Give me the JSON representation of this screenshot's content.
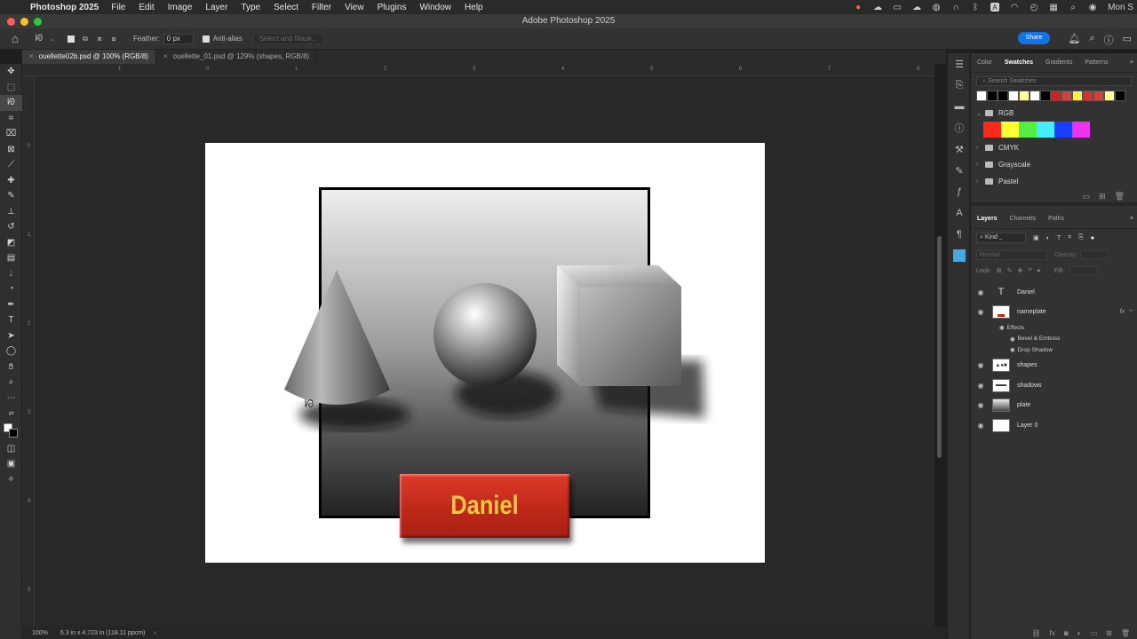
{
  "menubar": {
    "app": "Photoshop 2025",
    "items": [
      "File",
      "Edit",
      "Image",
      "Layer",
      "Type",
      "Select",
      "Filter",
      "View",
      "Plugins",
      "Window",
      "Help"
    ],
    "clock": "Mon S"
  },
  "window_title": "Adobe Photoshop 2025",
  "options": {
    "feather_label": "Feather:",
    "feather_value": "0 px",
    "antialias_label": "Anti-alias",
    "select_mask_label": "Select and Mask...",
    "share_label": "Share"
  },
  "tabs": [
    {
      "label": "ouellette02b.psd @ 100% (RGB/8)",
      "active": true
    },
    {
      "label": "ouellette_01.psd @ 129% (shapes, RGB/8)",
      "active": false
    }
  ],
  "rulers": {
    "h": [
      "1",
      "0",
      "1",
      "2",
      "3",
      "4",
      "5",
      "6",
      "7",
      "8"
    ],
    "v": [
      "0",
      "1",
      "2",
      "3",
      "4",
      "5"
    ]
  },
  "canvas": {
    "nameplate_text": "Daniel",
    "nameplate_color": "#c02a1a",
    "nameplate_text_color": "#f5c842"
  },
  "status": {
    "zoom": "100%",
    "doc_info": "6.3 in x 4.723 in (118.11 ppcm)"
  },
  "swatches_panel": {
    "tabs": [
      "Color",
      "Swatches",
      "Gradients",
      "Patterns"
    ],
    "active_tab": "Swatches",
    "search_placeholder": "Search Swatches",
    "recent": [
      "#ffffff",
      "#000000",
      "#000000",
      "#ffffff",
      "#ffff99",
      "#ffffff",
      "#000000",
      "#cc2222",
      "#cc4444",
      "#ffee55",
      "#cc3333",
      "#cc4444",
      "#ffff99",
      "#000000"
    ],
    "groups": [
      {
        "name": "RGB",
        "open": true,
        "colors": [
          "#ff2a1a",
          "#ffff33",
          "#55ee44",
          "#44eeff",
          "#1a3dff",
          "#ee33ee"
        ]
      },
      {
        "name": "CMYK",
        "open": false
      },
      {
        "name": "Grayscale",
        "open": false
      },
      {
        "name": "Pastel",
        "open": false
      }
    ]
  },
  "layers_panel": {
    "tabs": [
      "Layers",
      "Channels",
      "Paths"
    ],
    "active_tab": "Layers",
    "filter_label": "Kind",
    "blend_mode": "Normal",
    "opacity_label": "Opacity:",
    "lock_label": "Lock:",
    "fill_label": "Fill:",
    "effects_label": "Effects",
    "layers": [
      {
        "name": "Daniel",
        "type": "text"
      },
      {
        "name": "nameplate",
        "type": "shape",
        "effects": [
          "Bevel & Emboss",
          "Drop Shadow"
        ]
      },
      {
        "name": "shapes",
        "type": "pixel"
      },
      {
        "name": "shadows",
        "type": "pixel"
      },
      {
        "name": "plate",
        "type": "pixel"
      },
      {
        "name": "Layer 0",
        "type": "pixel"
      }
    ]
  }
}
